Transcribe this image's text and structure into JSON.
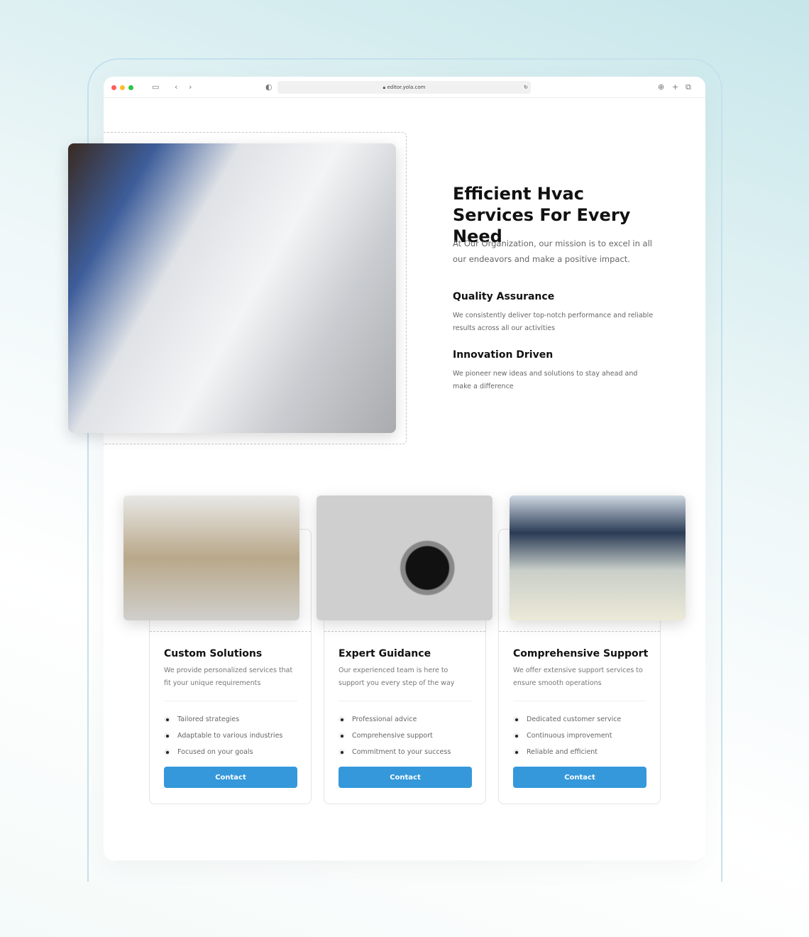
{
  "browser": {
    "url": "editor.yola.com",
    "dots": [
      "#ff5f57",
      "#febc2e",
      "#28c840"
    ]
  },
  "hero": {
    "title": "Efficient Hvac Services For Every Need",
    "intro": "At Our Organization, our mission is to excel in all our endeavors and make a positive impact.",
    "features": [
      {
        "title": "Quality Assurance",
        "text": "We consistently deliver top-notch performance and reliable results across all our activities"
      },
      {
        "title": "Innovation Driven",
        "text": "We pioneer new ideas and solutions to stay ahead and make a difference"
      }
    ]
  },
  "cards": [
    {
      "title": "Custom Solutions",
      "text": "We provide personalized services that fit your unique requirements",
      "items": [
        "Tailored strategies",
        "Adaptable to various industries",
        "Focused on your goals"
      ],
      "button": "Contact"
    },
    {
      "title": "Expert Guidance",
      "text": "Our experienced team is here to support you every step of the way",
      "items": [
        "Professional advice",
        "Comprehensive support",
        "Commitment to your success"
      ],
      "button": "Contact"
    },
    {
      "title": "Comprehensive Support",
      "text": "We offer extensive support services to ensure smooth operations",
      "items": [
        "Dedicated customer service",
        "Continuous improvement",
        "Reliable and efficient"
      ],
      "button": "Contact"
    }
  ],
  "accent": "#3498db"
}
